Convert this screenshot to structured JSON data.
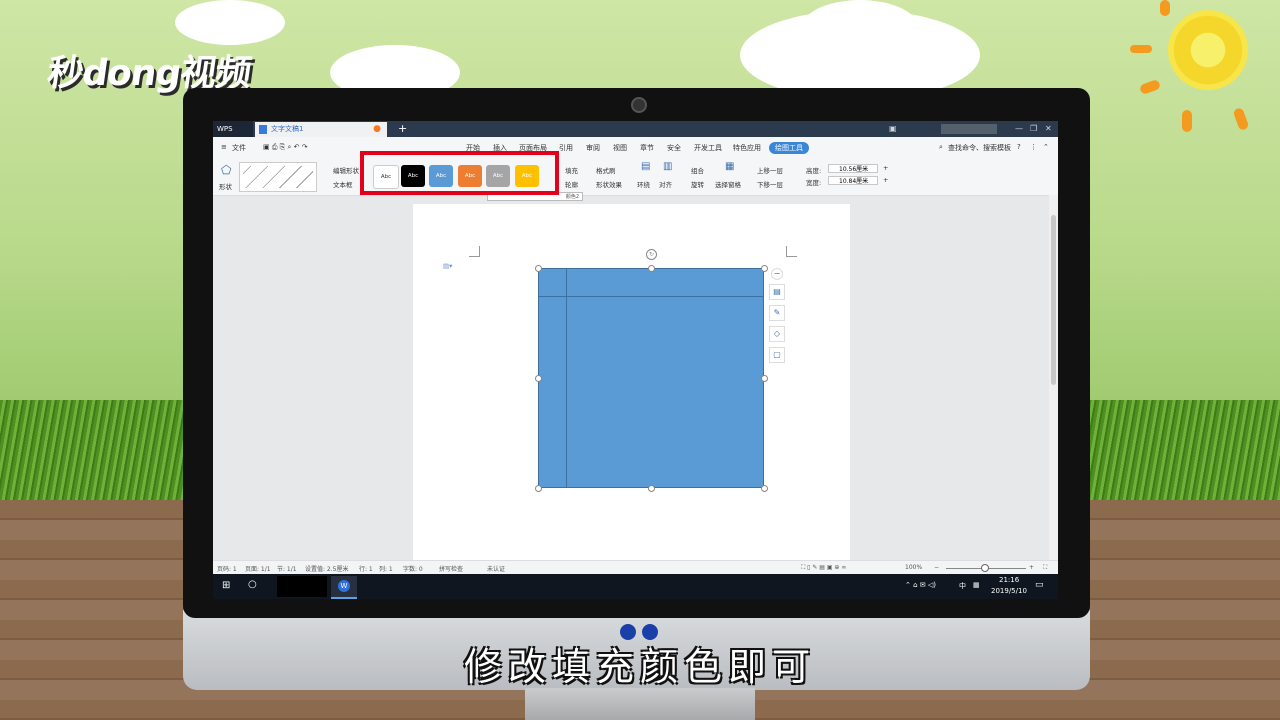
{
  "brand": {
    "logo": "秒dong视频"
  },
  "subtitle": "修改填充颜色即可",
  "titlebar": {
    "wps": "WPS",
    "doc_tab": "文字文稿1",
    "new_tab": "+"
  },
  "menubar": {
    "file": "文件",
    "tabs": [
      "开始",
      "插入",
      "页面布局",
      "引用",
      "审阅",
      "视图",
      "章节",
      "安全",
      "开发工具",
      "特色应用",
      "绘图工具"
    ],
    "active_tab": "绘图工具",
    "search": "查找命令、搜索模板"
  },
  "ribbon": {
    "shape": "形状",
    "edit_shape": "编辑形状",
    "textbox": "文本框",
    "fill": "填充",
    "outline": "轮廓",
    "format_painter": "格式刷",
    "shape_effect": "形状效果",
    "wrap": "环绕",
    "align": "对齐",
    "group": "组合",
    "rotate": "旋转",
    "select_pane": "选择窗格",
    "bring_forward": "上移一层",
    "send_backward": "下移一层",
    "height_label": "高度:",
    "height_value": "10.56厘米",
    "width_label": "宽度:",
    "width_value": "10.84厘米",
    "tooltip": "颜色2",
    "style_swatches": [
      {
        "label": "Abc",
        "bg": "#ffffff",
        "fg": "#333333"
      },
      {
        "label": "Abc",
        "bg": "#000000",
        "fg": "#ffffff"
      },
      {
        "label": "Abc",
        "bg": "#5b9bd5",
        "fg": "#ffffff"
      },
      {
        "label": "Abc",
        "bg": "#ed7d31",
        "fg": "#ffffff"
      },
      {
        "label": "Abc",
        "bg": "#a5a5a5",
        "fg": "#ffffff"
      },
      {
        "label": "Abc",
        "bg": "#ffc000",
        "fg": "#ffffff"
      }
    ]
  },
  "document": {
    "shape_fill": "#5b9bd5"
  },
  "statusbar": {
    "page_num": "页码: 1",
    "pages": "页面: 1/1",
    "section": "节: 1/1",
    "setting": "设置值: 2.5厘米",
    "row": "行: 1",
    "col": "列: 1",
    "words": "字数: 0",
    "spell": "拼写检查",
    "cert": "未认证",
    "zoom": "100%"
  },
  "taskbar": {
    "time": "21:16",
    "date": "2019/5/10",
    "ime": "中"
  }
}
